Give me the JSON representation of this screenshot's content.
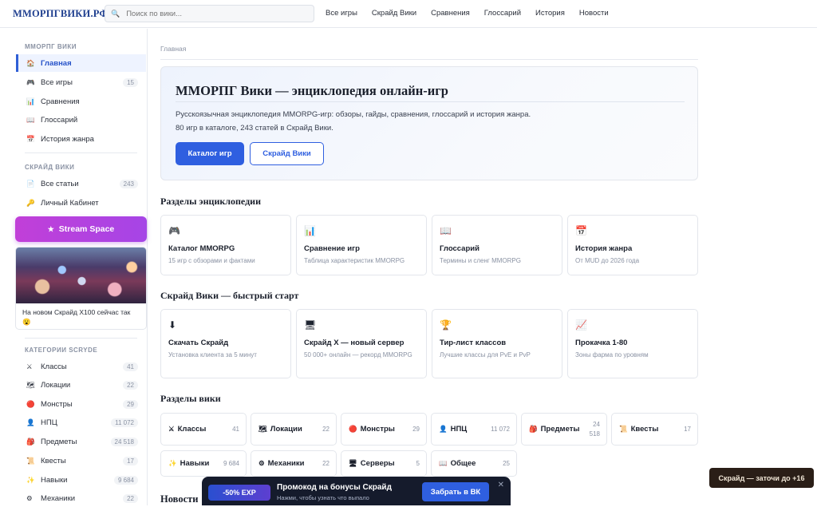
{
  "header": {
    "logo": "MMOРПГВИКИ.РФ",
    "search_placeholder": "Поиск по вики...",
    "nav": [
      "Все игры",
      "Скрайд Вики",
      "Сравнения",
      "Глоссарий",
      "История",
      "Новости"
    ]
  },
  "sidebar": {
    "section1_title": "MMOРПГ ВИКИ",
    "section1": [
      {
        "icon": "🏠",
        "label": "Главная",
        "count": ""
      },
      {
        "icon": "🎮",
        "label": "Все игры",
        "count": "15"
      },
      {
        "icon": "📊",
        "label": "Сравнения",
        "count": ""
      },
      {
        "icon": "📖",
        "label": "Глоссарий",
        "count": ""
      },
      {
        "icon": "📅",
        "label": "История жанра",
        "count": ""
      }
    ],
    "section2_title": "СКРАЙД ВИКИ",
    "section2": [
      {
        "icon": "📄",
        "label": "Все статьи",
        "count": "243"
      },
      {
        "icon": "🔑",
        "label": "Личный Кабинет",
        "count": ""
      }
    ],
    "stream_label": "Stream Space",
    "promo_text": "На новом Скрайд X100 сейчас так 😮",
    "section3_title": "КАТЕГОРИИ SCRYDE",
    "section3": [
      {
        "icon": "⚔",
        "label": "Классы",
        "count": "41"
      },
      {
        "icon": "🗺",
        "label": "Локации",
        "count": "22"
      },
      {
        "icon": "🔴",
        "label": "Монстры",
        "count": "29"
      },
      {
        "icon": "👤",
        "label": "НПЦ",
        "count": "11 072"
      },
      {
        "icon": "🎒",
        "label": "Предметы",
        "count": "24 518"
      },
      {
        "icon": "📜",
        "label": "Квесты",
        "count": "17"
      },
      {
        "icon": "✨",
        "label": "Навыки",
        "count": "9 684"
      },
      {
        "icon": "⚙",
        "label": "Механики",
        "count": "22"
      }
    ]
  },
  "main": {
    "breadcrumb": "Главная",
    "hero": {
      "title": "MMOРПГ Вики — энциклопедия онлайн-игр",
      "text": "Русскоязычная энциклопедия MMORPG-игр: обзоры, гайды, сравнения, глоссарий и история жанра. 80 игр в каталоге, 243 статей в Скрайд Вики.",
      "btn_primary": "Каталог игр",
      "btn_secondary": "Скрайд Вики"
    },
    "sections_title": "Разделы энциклопедии",
    "sections": [
      {
        "icon": "🎮",
        "title": "Каталог MMORPG",
        "desc": "15 игр с обзорами и фактами"
      },
      {
        "icon": "📊",
        "title": "Сравнение игр",
        "desc": "Таблица характеристик MMORPG"
      },
      {
        "icon": "📖",
        "title": "Глоссарий",
        "desc": "Термины и сленг MMORPG"
      },
      {
        "icon": "📅",
        "title": "История жанра",
        "desc": "От MUD до 2026 года"
      }
    ],
    "quick_title": "Скрайд Вики — быстрый старт",
    "quick": [
      {
        "icon": "⬇",
        "title": "Скачать Скрайд",
        "desc": "Установка клиента за 5 минут"
      },
      {
        "icon": "🖥",
        "title": "Скрайд X — новый сервер",
        "desc": "50 000+ онлайн — рекорд MMORPG"
      },
      {
        "icon": "🏆",
        "title": "Тир-лист классов",
        "desc": "Лучшие классы для PvE и PvP"
      },
      {
        "icon": "📈",
        "title": "Прокачка 1-80",
        "desc": "Зоны фарма по уровням"
      }
    ],
    "wiki_title": "Разделы вики",
    "wiki_row1": [
      {
        "icon": "⚔",
        "label": "Классы",
        "count": "41"
      },
      {
        "icon": "🗺",
        "label": "Локации",
        "count": "22"
      },
      {
        "icon": "🔴",
        "label": "Монстры",
        "count": "29"
      },
      {
        "icon": "👤",
        "label": "НПЦ",
        "count": "11 072"
      },
      {
        "icon": "🎒",
        "label": "Предметы",
        "count": "24 518"
      },
      {
        "icon": "📜",
        "label": "Квесты",
        "count": "17"
      }
    ],
    "wiki_row2": [
      {
        "icon": "✨",
        "label": "Навыки",
        "count": "9 684"
      },
      {
        "icon": "⚙",
        "label": "Механики",
        "count": "22"
      },
      {
        "icon": "🖥",
        "label": "Серверы",
        "count": "5"
      },
      {
        "icon": "📖",
        "label": "Общее",
        "count": "25"
      }
    ],
    "news_title": "Новости"
  },
  "banner": {
    "exp": "-50% EXP",
    "title": "Промокод на бонусы Скрайд",
    "subtitle": "Нажми, чтобы узнать что выпало",
    "button": "Забрать в ВК",
    "close": "✕"
  },
  "toast": "Скрайд — заточи до +16"
}
